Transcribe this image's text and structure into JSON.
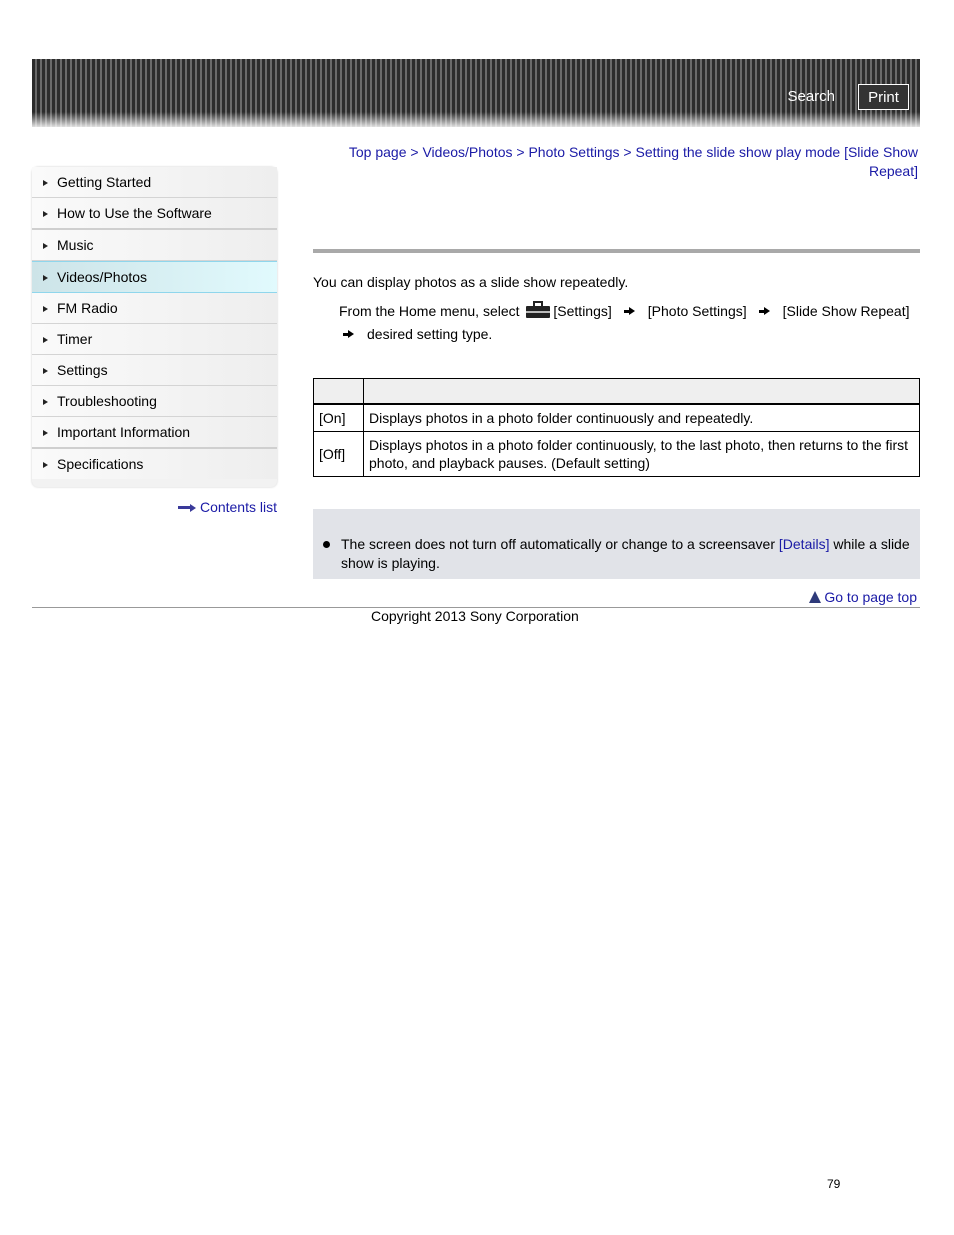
{
  "header": {
    "search_label": "Search",
    "print_label": "Print"
  },
  "sidebar": {
    "items": [
      {
        "label": "Getting Started",
        "active": false
      },
      {
        "label": "How to Use the Software",
        "active": false
      },
      {
        "label": "Music",
        "active": false
      },
      {
        "label": "Videos/Photos",
        "active": true
      },
      {
        "label": "FM Radio",
        "active": false
      },
      {
        "label": "Timer",
        "active": false
      },
      {
        "label": "Settings",
        "active": false
      },
      {
        "label": "Troubleshooting",
        "active": false
      },
      {
        "label": "Important Information",
        "active": false
      },
      {
        "label": "Specifications",
        "active": false
      }
    ],
    "contents_list_label": "Contents list"
  },
  "breadcrumb": {
    "items": [
      "Top page",
      "Videos/Photos",
      "Photo Settings",
      "Setting the slide show play mode [Slide Show Repeat]"
    ],
    "separator": " > "
  },
  "main": {
    "intro": "You can display photos as a slide show repeatedly.",
    "step": {
      "prefix": "From the Home menu, select ",
      "icon": "toolbox-settings-icon",
      "parts": [
        "[Settings]",
        "[Photo Settings]",
        "[Slide Show Repeat]"
      ],
      "last": "desired setting type."
    },
    "table": {
      "headers": [
        "",
        ""
      ],
      "rows": [
        {
          "setting": "[On]",
          "description": "Displays photos in a photo folder continuously and repeatedly."
        },
        {
          "setting": "[Off]",
          "description": "Displays photos in a photo folder continuously, to the last photo, then returns to the first photo, and playback pauses. (Default setting)"
        }
      ]
    },
    "note": {
      "before": "The screen does not turn off automatically or change to a screensaver ",
      "link": "[Details]",
      "after": " while a slide show is playing."
    },
    "go_to_top": "Go to page top"
  },
  "footer": {
    "copyright": "Copyright 2013 Sony Corporation",
    "page_number": "79"
  },
  "colors": {
    "link": "#1a1aa6",
    "active_nav": "#e1fafd",
    "note_bg": "#e1e3e8"
  }
}
